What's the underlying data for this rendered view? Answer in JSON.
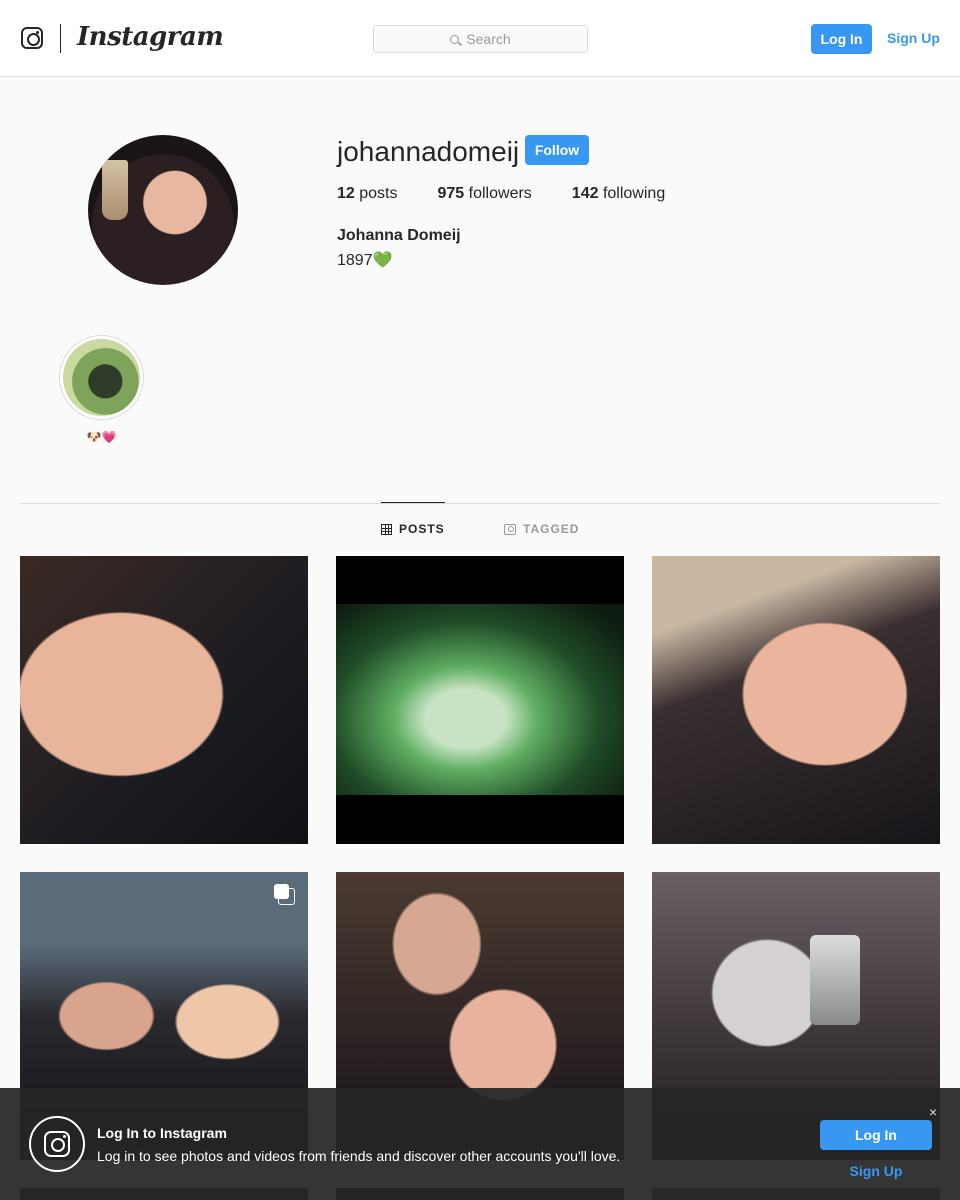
{
  "nav": {
    "wordmark": "Instagram",
    "search_placeholder": "Search",
    "login_label": "Log In",
    "signup_label": "Sign Up",
    "icons": [
      "instagram-glyph-icon",
      "search-icon"
    ]
  },
  "profile": {
    "username": "johannadomeij",
    "follow_label": "Follow",
    "stats": {
      "posts_count": "12",
      "posts_label": "posts",
      "followers_count": "975",
      "followers_label": "followers",
      "following_count": "142",
      "following_label": "following"
    },
    "full_name": "Johanna Domeij",
    "bio": "1897💚"
  },
  "highlights": [
    {
      "label": "🐶💗"
    }
  ],
  "tabs": [
    {
      "label": "POSTS",
      "active": true,
      "icon": "grid-icon"
    },
    {
      "label": "TAGGED",
      "active": false,
      "icon": "tagged-icon"
    }
  ],
  "posts": [
    {
      "multiple": false
    },
    {
      "multiple": false
    },
    {
      "multiple": false
    },
    {
      "multiple": true
    },
    {
      "multiple": false
    },
    {
      "multiple": false
    }
  ],
  "banner": {
    "title": "Log In to Instagram",
    "text": "Log in to see photos and videos from friends and discover other accounts you'll love.",
    "login_label": "Log In",
    "signup_label": "Sign Up",
    "close_symbol": "×"
  },
  "colors": {
    "accent": "#3897f0",
    "text": "#262626",
    "background": "#fafafa",
    "border": "#dbdbdb"
  }
}
